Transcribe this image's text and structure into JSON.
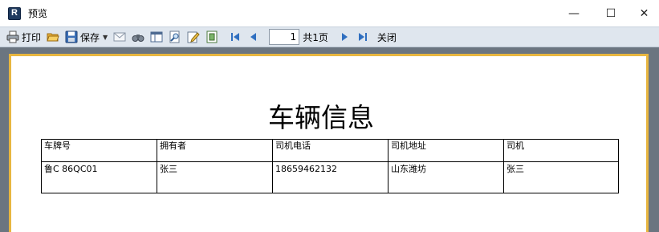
{
  "window": {
    "title": "预览",
    "app_icon_letter": "R",
    "controls": {
      "minimize": "—",
      "maximize": "☐",
      "close": "✕"
    }
  },
  "toolbar": {
    "print_label": "打印",
    "save_label": "保存",
    "page_current": "1",
    "page_total_label": "共1页",
    "close_label": "关闭"
  },
  "report": {
    "title": "车辆信息",
    "columns": [
      "车牌号",
      "拥有者",
      "司机电话",
      "司机地址",
      "司机"
    ],
    "rows": [
      [
        "鲁C 86QC01",
        "张三",
        "18659462132",
        "山东潍坊",
        "张三"
      ]
    ]
  },
  "colors": {
    "toolbar_bg": "#dfe6ee",
    "preview_bg": "#6b7580",
    "page_border": "#e8b640"
  }
}
